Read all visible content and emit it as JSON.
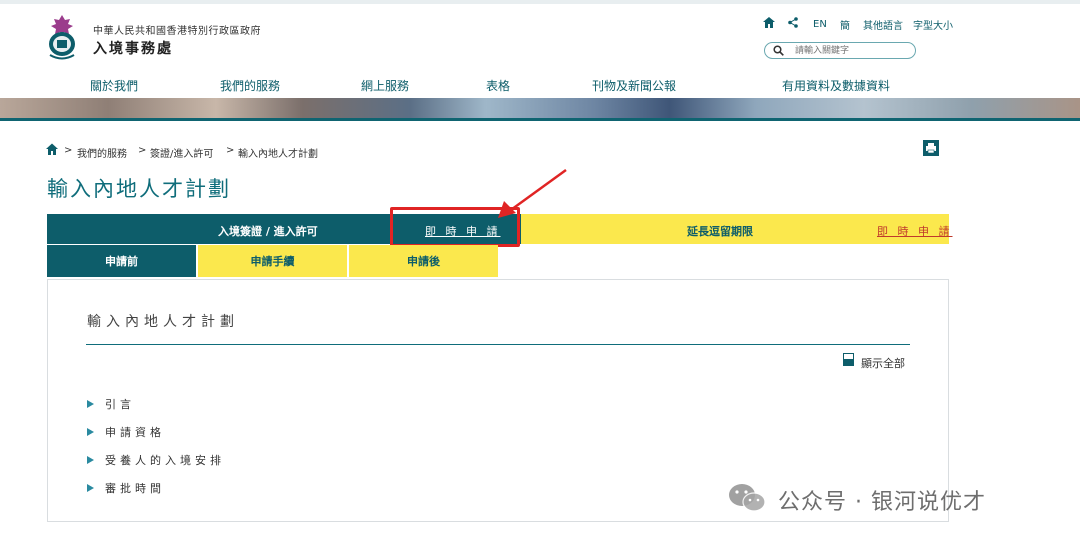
{
  "header": {
    "gov_name": "中華人民共和國香港特別行政區政府",
    "dept_name": "入境事務處",
    "tools": {
      "lang_en": "EN",
      "lang_sc": "簡",
      "other_lang": "其他語言",
      "font_size": "字型大小"
    },
    "search": {
      "placeholder": "請輸入關鍵字"
    },
    "nav": [
      "關於我們",
      "我們的服務",
      "網上服務",
      "表格",
      "刊物及新聞公報",
      "有用資料及數據資料"
    ]
  },
  "breadcrumb": [
    "我們的服務",
    "簽證/進入許可",
    "輸入內地人才計劃"
  ],
  "page_title": "輸入內地人才計劃",
  "tabs_row1": {
    "entry_permit": "入境簽證 / 進入許可",
    "apply_now_1": "即 時 申 請",
    "extension": "延長逗留期限",
    "apply_now_2": "即 時 申 請"
  },
  "tabs_row2": [
    "申請前",
    "申請手續",
    "申請後"
  ],
  "content": {
    "section_title": "輸入內地人才計劃",
    "show_all": "顯示全部",
    "items": [
      "引言",
      "申請資格",
      "受養人的入境安排",
      "審批時間"
    ]
  },
  "watermark": "公众号 · 银河说优才",
  "colors": {
    "teal": "#0d5d6a",
    "yellow": "#fbe84d",
    "title_teal": "#0f6d7b",
    "annotation_red": "#e02424",
    "link_orange": "#c0392b"
  }
}
